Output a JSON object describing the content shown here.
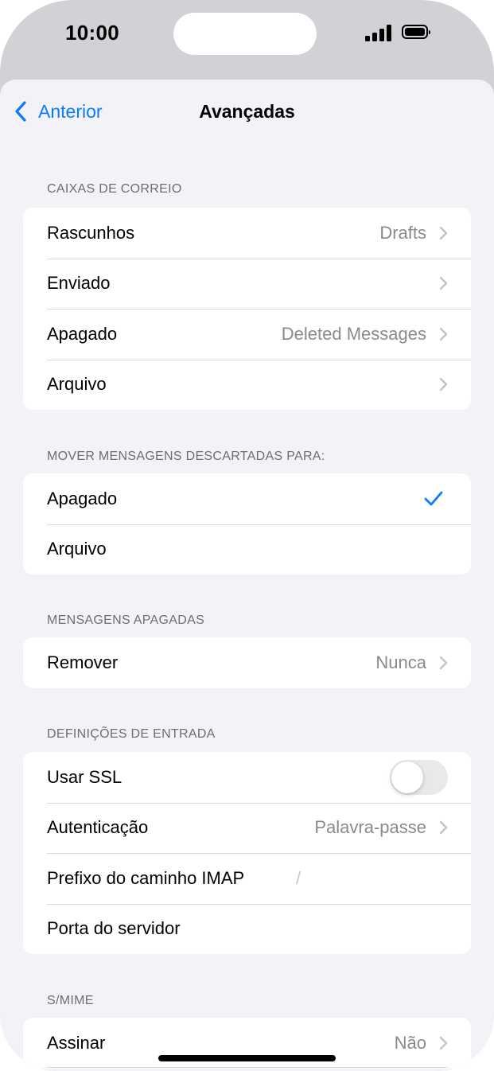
{
  "status_bar": {
    "time": "10:00"
  },
  "nav": {
    "back_label": "Anterior",
    "title": "Avançadas"
  },
  "sections": {
    "mailboxes": {
      "header": "CAIXAS DE CORREIO",
      "rows": [
        {
          "label": "Rascunhos",
          "value": "Drafts"
        },
        {
          "label": "Enviado",
          "value": ""
        },
        {
          "label": "Apagado",
          "value": "Deleted Messages"
        },
        {
          "label": "Arquivo",
          "value": ""
        }
      ]
    },
    "move_discarded": {
      "header": "MOVER MENSAGENS DESCARTADAS PARA:",
      "rows": [
        {
          "label": "Apagado",
          "selected": true
        },
        {
          "label": "Arquivo",
          "selected": false
        }
      ]
    },
    "deleted_messages": {
      "header": "MENSAGENS APAGADAS",
      "rows": [
        {
          "label": "Remover",
          "value": "Nunca"
        }
      ]
    },
    "incoming": {
      "header": "DEFINIÇÕES DE ENTRADA",
      "rows": [
        {
          "label": "Usar SSL",
          "toggle_on": false
        },
        {
          "label": "Autenticação",
          "value": "Palavra-passe"
        },
        {
          "label": "Prefixo do caminho IMAP",
          "value": "/"
        },
        {
          "label": "Porta do servidor"
        }
      ]
    },
    "smime": {
      "header": "S/MIME",
      "rows": [
        {
          "label": "Assinar",
          "value": "Não"
        }
      ]
    }
  },
  "colors": {
    "accent": "#0a7aff",
    "background": "#f2f2f7",
    "secondary_text": "#8a8a8e"
  }
}
